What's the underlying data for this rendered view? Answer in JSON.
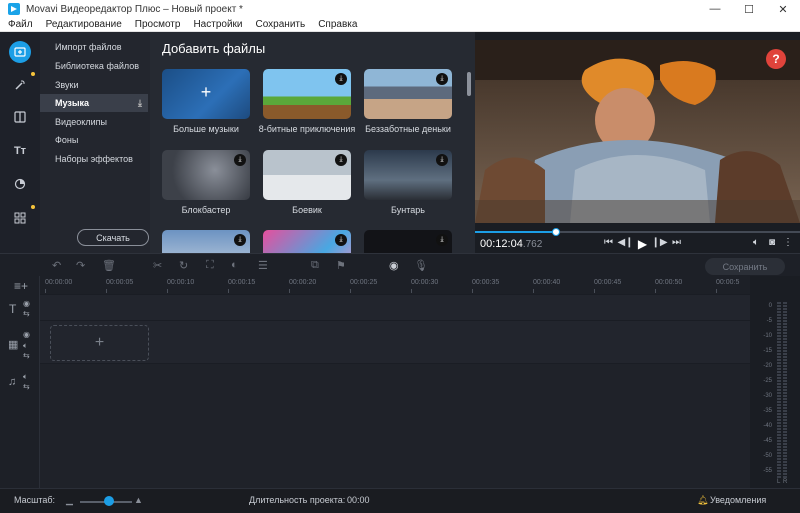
{
  "window": {
    "title": "Movavi Видеоредактор Плюс – Новый проект *",
    "minimize": "—",
    "maximize": "☐",
    "close": "✕"
  },
  "menu": [
    "Файл",
    "Редактирование",
    "Просмотр",
    "Настройки",
    "Сохранить",
    "Справка"
  ],
  "sidebar_icons": [
    "import-icon",
    "magic-wand-icon",
    "transitions-icon",
    "titles-icon",
    "filters-icon",
    "more-tools-icon"
  ],
  "categories": [
    {
      "label": "Импорт файлов"
    },
    {
      "label": "Библиотека файлов"
    },
    {
      "label": "Звуки"
    },
    {
      "label": "Музыка",
      "selected": true
    },
    {
      "label": "Видеоклипы"
    },
    {
      "label": "Фоны"
    },
    {
      "label": "Наборы эффектов"
    }
  ],
  "download_button": "Скачать",
  "content": {
    "heading": "Добавить файлы",
    "tiles": [
      {
        "label": "Больше музыки",
        "icon": "+"
      },
      {
        "label": "8-битные приключения"
      },
      {
        "label": "Беззаботные деньки"
      },
      {
        "label": "Блокбастер"
      },
      {
        "label": "Боевик"
      },
      {
        "label": "Бунтарь"
      }
    ]
  },
  "preview": {
    "help": "?",
    "time": "00:12:04",
    "time_ms": ".762",
    "progress_fraction": 0.25
  },
  "toolbar": {
    "save": "Сохранить"
  },
  "ruler": [
    "00:00:00",
    "00:00:05",
    "00:00:10",
    "00:00:15",
    "00:00:20",
    "00:00:25",
    "00:00:30",
    "00:00:35",
    "00:00:40",
    "00:00:45",
    "00:00:50",
    "00:00:5"
  ],
  "meter_labels": [
    "0",
    "-5",
    "-10",
    "-15",
    "-20",
    "-25",
    "-30",
    "-35",
    "-40",
    "-45",
    "-50",
    "-55"
  ],
  "meter_lr": [
    "L",
    "R"
  ],
  "status": {
    "zoom_label": "Масштаб:",
    "duration_label": "Длительность проекта:",
    "duration_value": "00:00",
    "notifications": "Уведомления"
  },
  "colors": {
    "accent": "#1c9ee6",
    "help": "#e0433b",
    "background": "#1a1d24"
  }
}
